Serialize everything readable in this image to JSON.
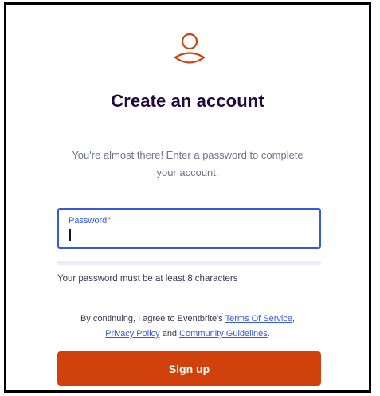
{
  "header": {
    "logo_icon": "user-icon",
    "title": "Create an account",
    "subtitle": "You're almost there! Enter a password to complete your account."
  },
  "form": {
    "password_label": "Password",
    "password_required_mark": "*",
    "password_value": "",
    "password_hint": "Your password must be at least 8 characters"
  },
  "legal": {
    "prefix": "By continuing, I agree to Eventbrite's ",
    "terms_link": "Terms Of Service",
    "comma": ",",
    "privacy_link": "Privacy Policy",
    "and": " and ",
    "guidelines_link": "Community Guidelines",
    "period": "."
  },
  "actions": {
    "signup_label": "Sign up"
  },
  "colors": {
    "brand": "#d1410c",
    "accent_blue": "#3659e3",
    "title": "#1e0a3c",
    "muted": "#6f7287"
  }
}
